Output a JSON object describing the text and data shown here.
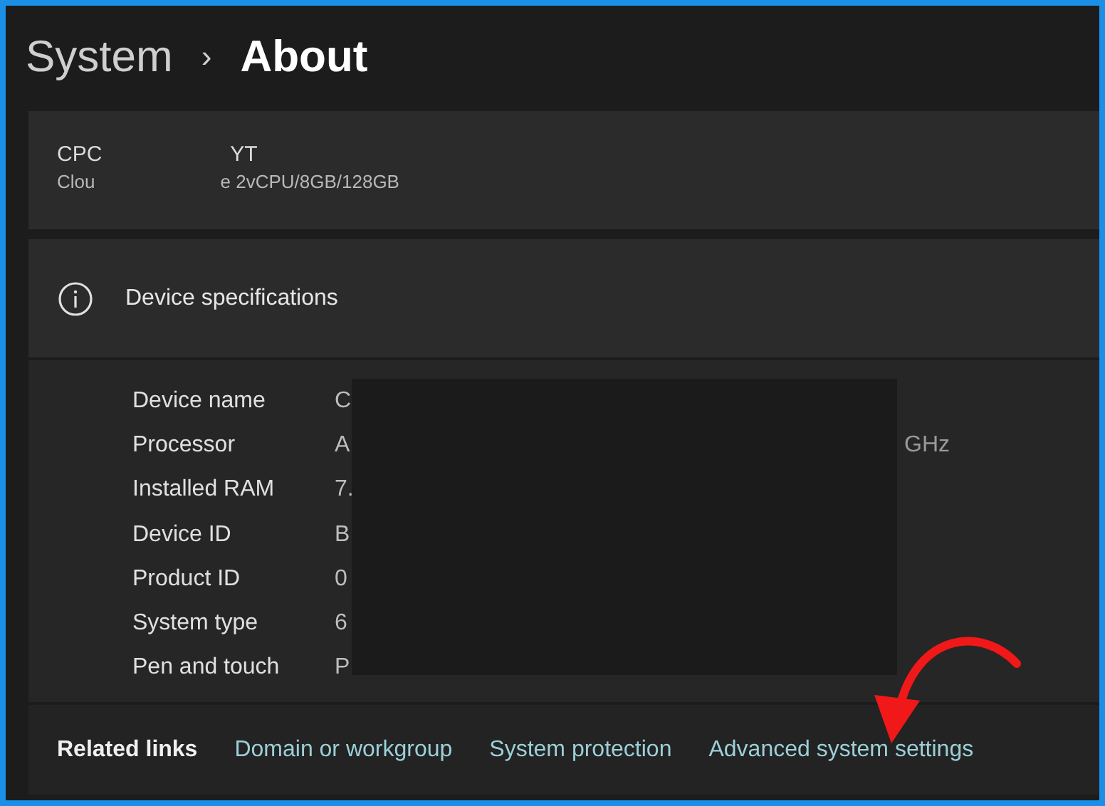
{
  "breadcrumb": {
    "parent": "System",
    "separator": "›",
    "current": "About"
  },
  "device": {
    "name_parts": [
      "CPC",
      "YT"
    ],
    "subtitle_parts": [
      "Clou",
      "e 2vCPU/8GB/128GB"
    ]
  },
  "specifications": {
    "title": "Device specifications",
    "rows": [
      {
        "label": "Device name",
        "value": "C"
      },
      {
        "label": "Processor",
        "value": "A",
        "value_end": "GHz"
      },
      {
        "label": "Installed RAM",
        "value": "7."
      },
      {
        "label": "Device ID",
        "value": "B"
      },
      {
        "label": "Product ID",
        "value": "0"
      },
      {
        "label": "System type",
        "value": "6"
      },
      {
        "label": "Pen and touch",
        "value": "P"
      }
    ]
  },
  "related_links": {
    "label": "Related links",
    "links": [
      "Domain or workgroup",
      "System protection",
      "Advanced system settings"
    ]
  }
}
